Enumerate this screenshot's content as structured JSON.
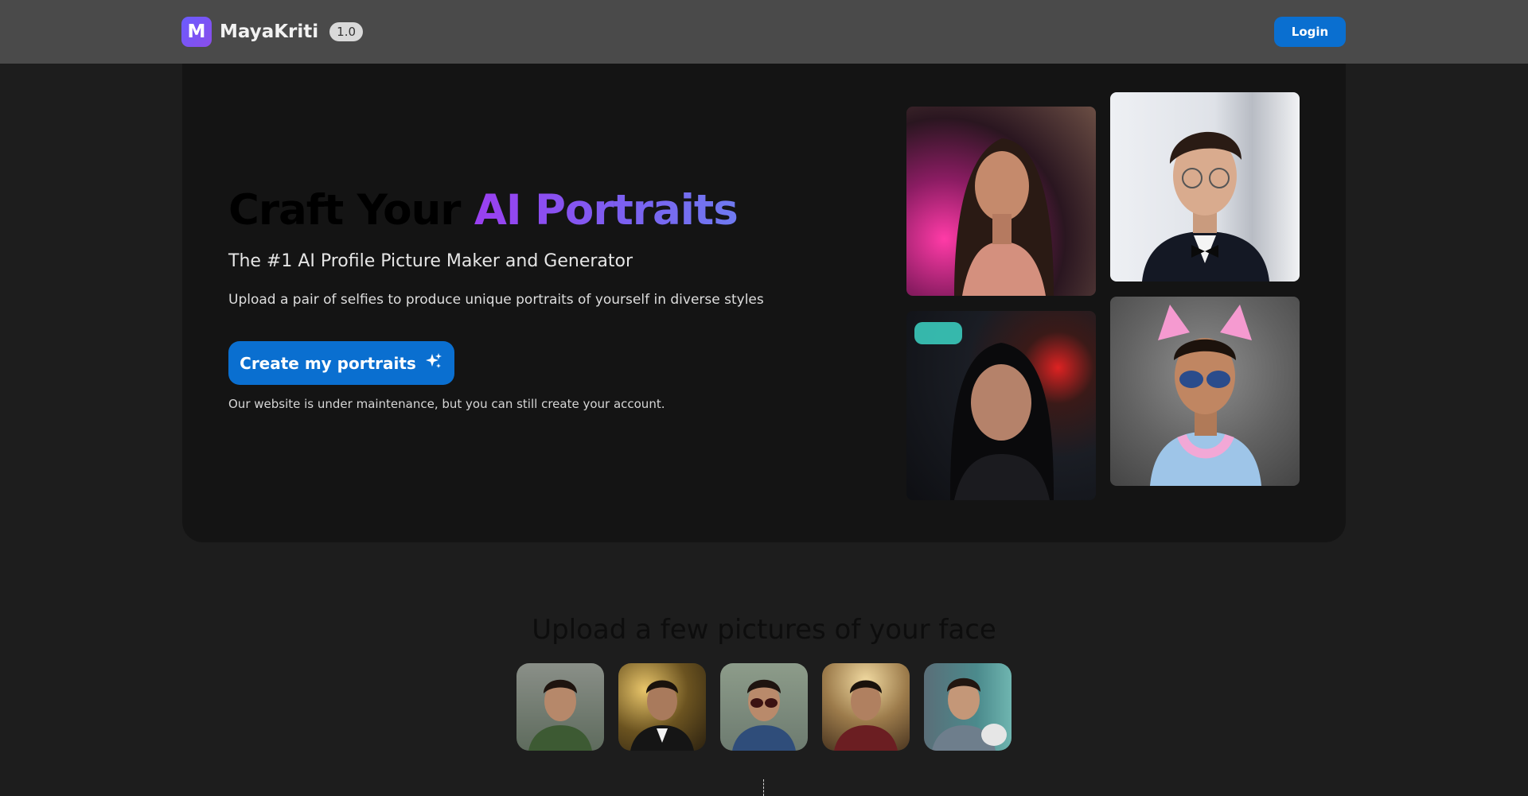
{
  "header": {
    "logo_letter": "M",
    "brand_name": "MayaKriti",
    "version": "1.0",
    "login_label": "Login"
  },
  "hero": {
    "title_prefix": "Craft Your",
    "title_accent": "AI Portraits",
    "subtitle": "The #1 AI Profile Picture Maker and Generator",
    "description": "Upload a pair of selfies to produce unique portraits of yourself in diverse styles",
    "cta_label": "Create my portraits",
    "cta_icon": "sparkles-icon",
    "notice": "Our website is under maintenance, but you can still create your account."
  },
  "upload": {
    "title": "Upload a few pictures of your face"
  },
  "colors": {
    "header_bg": "#4a4a4a",
    "page_bg": "#1d1d1d",
    "hero_bg": "#141414",
    "primary_button": "#0a6fd0",
    "accent_start": "#9a3ff0",
    "accent_end": "#6f7af0"
  }
}
